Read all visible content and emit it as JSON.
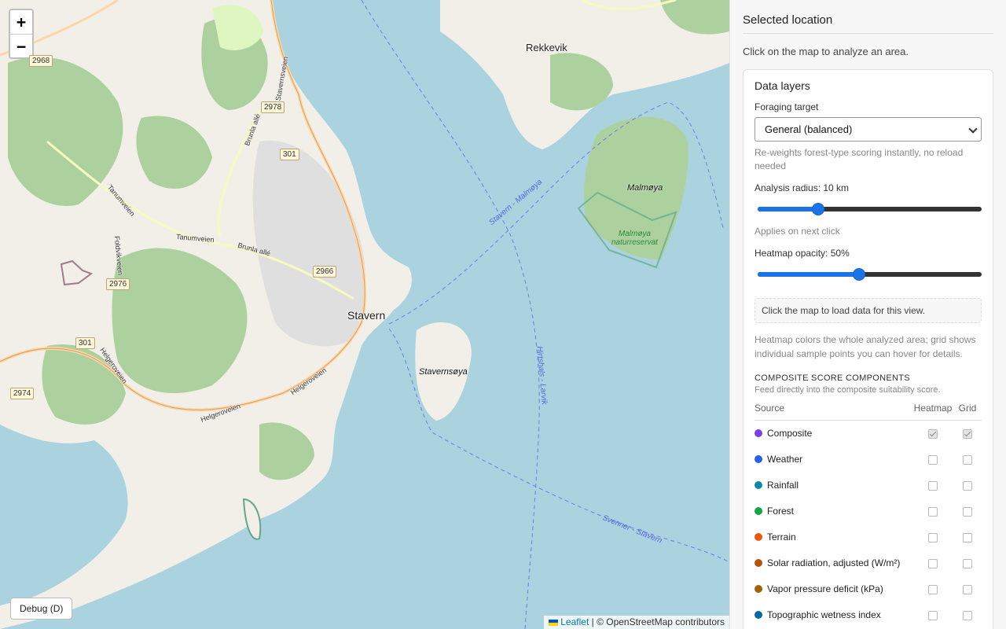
{
  "map": {
    "zoom_in": "+",
    "zoom_out": "−",
    "debug_button": "Debug (D)",
    "attribution": {
      "leaflet": "Leaflet",
      "rest": " | © OpenStreetMap contributors"
    },
    "places": {
      "rekkevik": "Rekkevik",
      "stavern": "Stavern"
    },
    "islands": {
      "malmoya": "Malmøya",
      "stavernsoya": "Stavernsøya"
    },
    "reserve": {
      "line1": "Malmøya",
      "line2": "naturreservat"
    },
    "shields": [
      "2968",
      "2978",
      "301",
      "2966",
      "2976",
      "301",
      "2974"
    ],
    "roads": {
      "tanumveien1": "Tanumveien",
      "tanumveien2": "Tanumveien",
      "brunia1": "Brunla allé",
      "brunia2": "Brunla allé",
      "foldvik": "Foldvikveien",
      "helgeroveien1": "Helgeroveien",
      "helgeroveien2": "Helgeroveien",
      "helgeroveien3": "Helgeroveien",
      "stavernsveien": "Stavernsveien"
    },
    "ferries": {
      "f1": "Stavern - Malmøya",
      "f2": "Hirtshals - Larvik",
      "f3": "Svenner - Stavern"
    }
  },
  "panel": {
    "title": "Selected location",
    "hint": "Click on the map to analyze an area.",
    "card_title": "Data layers",
    "foraging_label": "Foraging target",
    "foraging_value": "General (balanced)",
    "foraging_sub": "Re-weights forest-type scoring instantly, no reload needed",
    "radius_label": "Analysis radius: 10 km",
    "radius_fraction": 0.27,
    "radius_sub": "Applies on next click",
    "opacity_label": "Heatmap opacity: 50%",
    "opacity_fraction": 0.45,
    "status": "Click the map to load data for this view.",
    "note": "Heatmap colors the whole analyzed area; grid shows individual sample points you can hover for details.",
    "section_title": "COMPOSITE SCORE COMPONENTS",
    "section_sub": "Feed directly into the composite suitability score.",
    "columns": {
      "source": "Source",
      "heatmap": "Heatmap",
      "grid": "Grid"
    },
    "rows": [
      {
        "name": "Composite",
        "color": "#7b3fe4",
        "heatmap": true,
        "grid": true
      },
      {
        "name": "Weather",
        "color": "#2563eb",
        "heatmap": false,
        "grid": false
      },
      {
        "name": "Rainfall",
        "color": "#0e8aa8",
        "heatmap": false,
        "grid": false
      },
      {
        "name": "Forest",
        "color": "#16a34a",
        "heatmap": false,
        "grid": false
      },
      {
        "name": "Terrain",
        "color": "#ea580c",
        "heatmap": false,
        "grid": false
      },
      {
        "name": "Solar radiation, adjusted (W/m²)",
        "color": "#b45309",
        "heatmap": false,
        "grid": false
      },
      {
        "name": "Vapor pressure deficit (kPa)",
        "color": "#a16207",
        "heatmap": false,
        "grid": false
      },
      {
        "name": "Topographic wetness index",
        "color": "#0369a1",
        "heatmap": false,
        "grid": false
      }
    ]
  }
}
